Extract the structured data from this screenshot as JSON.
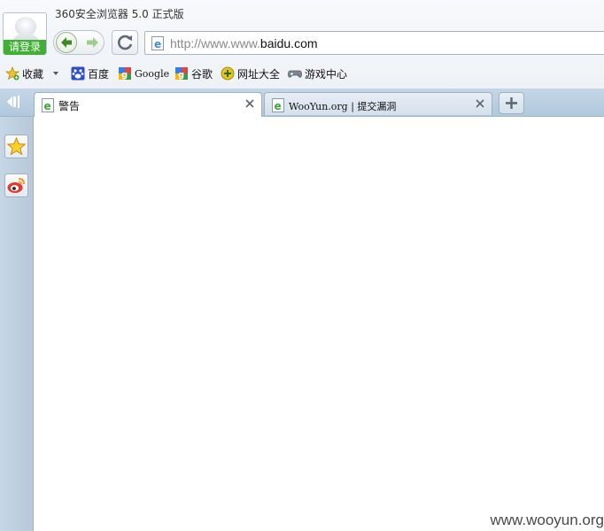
{
  "window": {
    "title": "360安全浏览器 5.0 正式版"
  },
  "account": {
    "login_label": "请登录"
  },
  "address_bar": {
    "url_prefix": "http://www.www.",
    "url_domain": "baidu.com"
  },
  "favorites": {
    "items": [
      {
        "label": "收藏",
        "icon": "star-collect-icon"
      },
      {
        "label": "百度",
        "icon": "baidu-paw-icon"
      },
      {
        "label": "Google",
        "icon": "google-icon"
      },
      {
        "label": "谷歌",
        "icon": "google-icon"
      },
      {
        "label": "网址大全",
        "icon": "url-directory-icon"
      },
      {
        "label": "游戏中心",
        "icon": "gamepad-icon"
      }
    ]
  },
  "tabs": [
    {
      "label": "警告",
      "active": true,
      "icon": "ie-page-icon"
    },
    {
      "label": "WooYun.org | 提交漏洞",
      "active": false,
      "icon": "ie-page-icon"
    }
  ],
  "sidebar": {
    "items": [
      {
        "icon": "favorites-star-icon"
      },
      {
        "icon": "weibo-icon"
      }
    ]
  },
  "content": {
    "watermark": "www.wooyun.org"
  },
  "colors": {
    "login_green": "#3fb033",
    "tabstrip_blue": "#b9cfe2",
    "nav_arrow_green": "#3b8a25"
  }
}
